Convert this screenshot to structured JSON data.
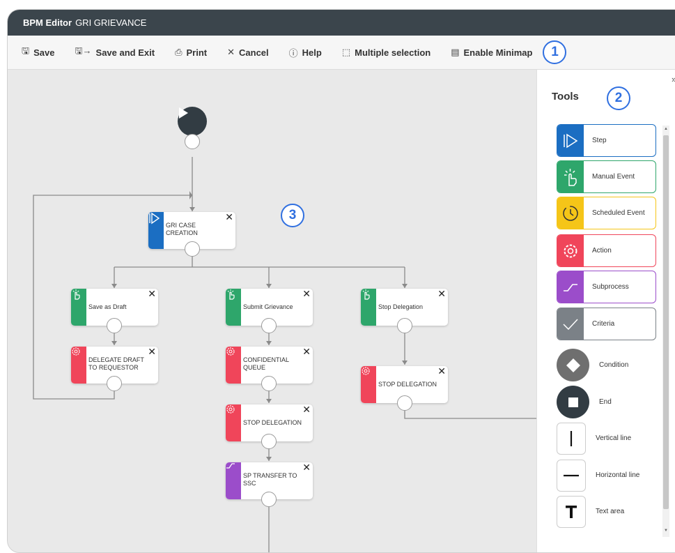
{
  "titlebar": {
    "app": "BPM Editor",
    "document": "GRI GRIEVANCE"
  },
  "toolbar": {
    "save": "Save",
    "save_exit": "Save and Exit",
    "print": "Print",
    "cancel": "Cancel",
    "help": "Help",
    "multi": "Multiple selection",
    "minimap": "Enable Minimap",
    "badge": "1"
  },
  "panel": {
    "title": "Tools",
    "badge": "2",
    "collapse": "»",
    "tools": {
      "step": "Step",
      "manual": "Manual Event",
      "scheduled": "Scheduled Event",
      "action": "Action",
      "subprocess": "Subprocess",
      "criteria": "Criteria",
      "condition": "Condition",
      "end": "End",
      "vline": "Vertical line",
      "hline": "Horizontal line",
      "text": "Text area"
    }
  },
  "canvas": {
    "badge": "3",
    "nodes": {
      "gri_case": "GRI CASE CREATION",
      "save_draft": "Save as Draft",
      "submit": "Submit Grievance",
      "stop_deleg_event": "Stop Delegation",
      "delegate_draft": "DELEGATE DRAFT TO REQUESTOR",
      "confidential": "CONFIDENTIAL QUEUE",
      "stop_deleg_action_right": "STOP DELEGATION",
      "stop_deleg_action_mid": "STOP DELEGATION",
      "sp_transfer": "SP TRANSFER TO SSC"
    },
    "close_symbol": "✕"
  },
  "colors": {
    "step": "#1b6ec2",
    "manual": "#2ea66b",
    "scheduled": "#f5c518",
    "action": "#f0455a",
    "subprocess": "#9b4dca",
    "criteria": "#7b8187",
    "condition": "#6f6f6f",
    "end": "#323c43",
    "accent": "#2f6fe0"
  }
}
